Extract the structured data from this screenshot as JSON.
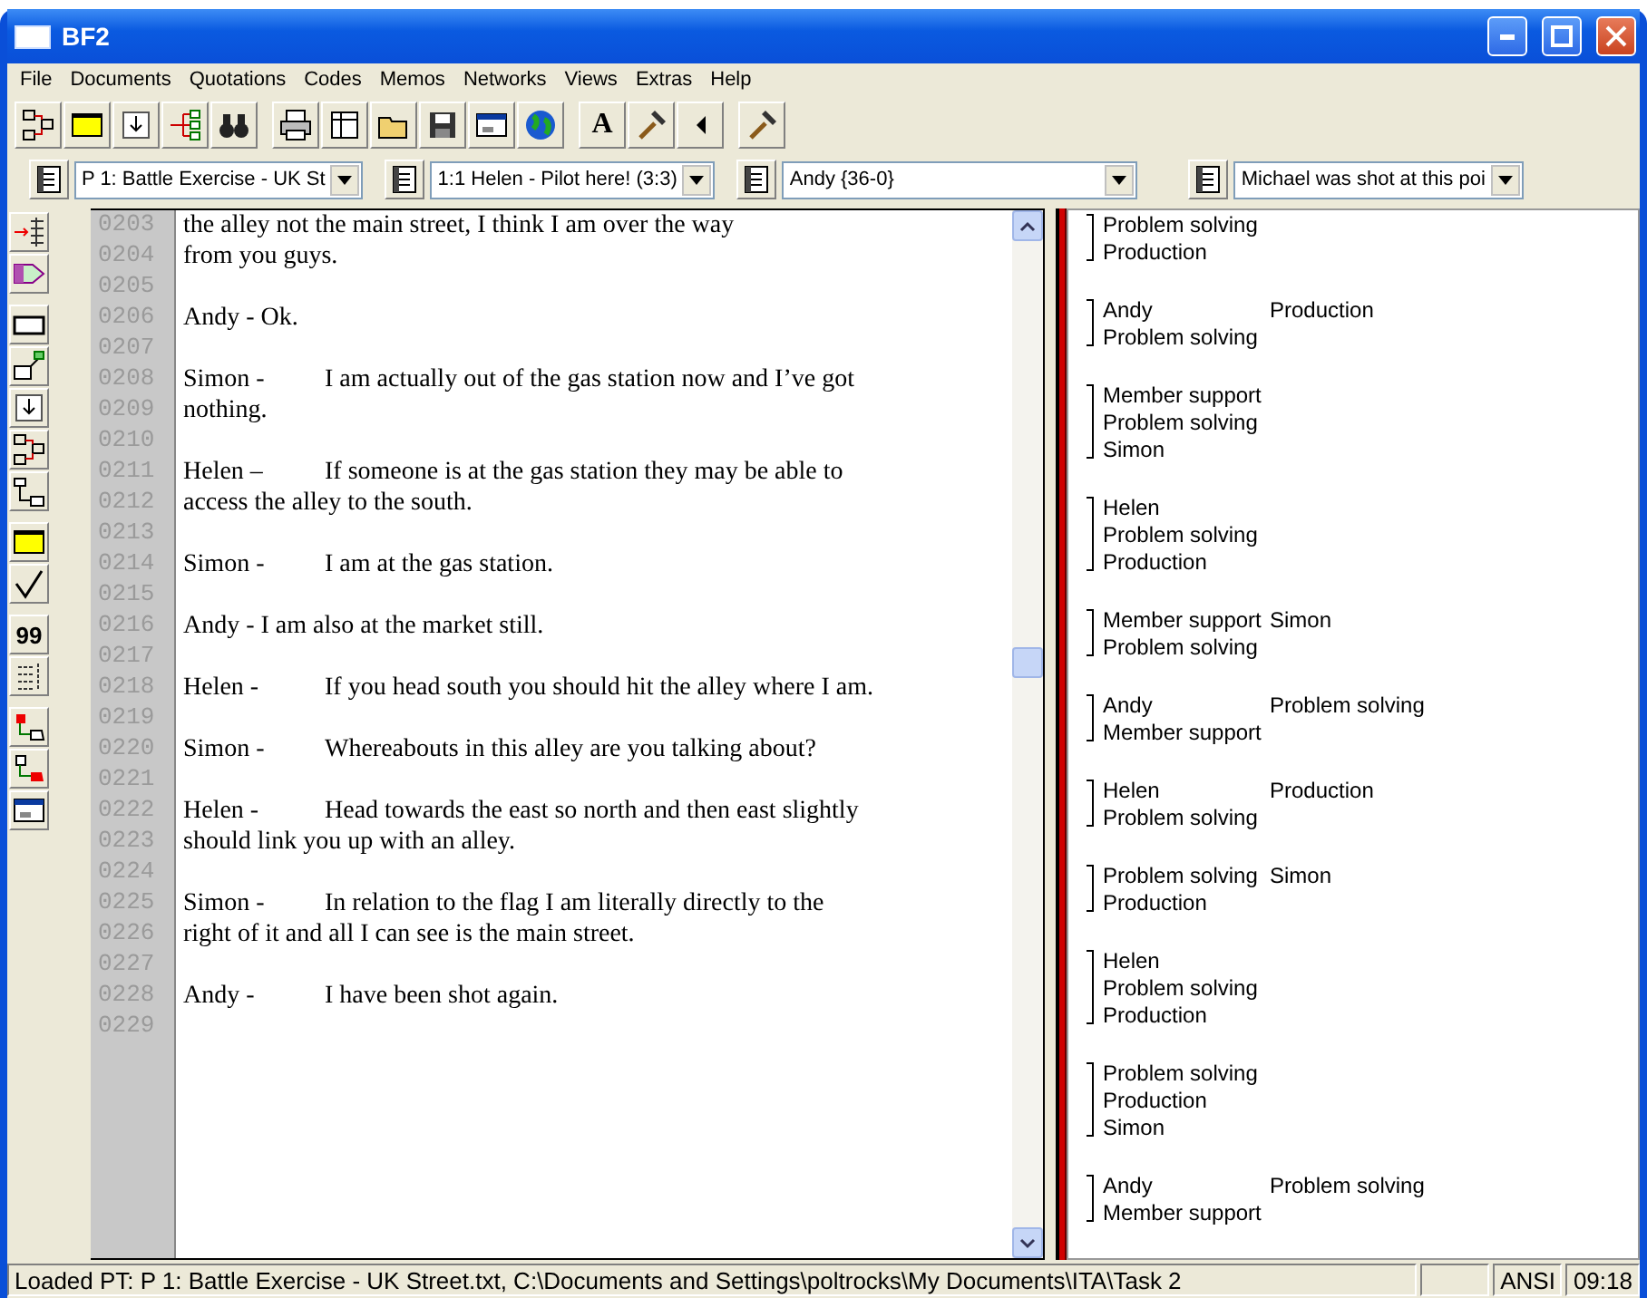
{
  "window": {
    "title": "BF2"
  },
  "menu": [
    "File",
    "Documents",
    "Quotations",
    "Codes",
    "Memos",
    "Networks",
    "Views",
    "Extras",
    "Help"
  ],
  "toolbar": [
    [
      {
        "kind": "network"
      },
      {
        "kind": "yellow-window"
      },
      {
        "kind": "import"
      },
      {
        "kind": "tree"
      },
      {
        "kind": "binoculars"
      }
    ],
    [
      {
        "kind": "printer"
      },
      {
        "kind": "table"
      },
      {
        "kind": "folder"
      },
      {
        "kind": "save"
      },
      {
        "kind": "window"
      },
      {
        "kind": "globe"
      }
    ],
    [
      {
        "kind": "text",
        "label": "A"
      },
      {
        "kind": "hammer"
      },
      {
        "kind": "left-arrow"
      }
    ],
    [
      {
        "kind": "hammer"
      }
    ]
  ],
  "selectors": [
    {
      "value": "P 1: Battle Exercise - UK St"
    },
    {
      "value": "1:1 Helen - Pilot here! (3:3)"
    },
    {
      "value": "Andy {36-0}"
    },
    {
      "value": "Michael was shot at this poi"
    }
  ],
  "side_toolbar": [
    [
      {
        "kind": "arrow-lines"
      },
      {
        "kind": "tag"
      }
    ],
    [
      {
        "kind": "rectangle"
      },
      {
        "kind": "memo-link"
      },
      {
        "kind": "import"
      },
      {
        "kind": "network"
      },
      {
        "kind": "connector"
      }
    ],
    [
      {
        "kind": "yellow-window"
      },
      {
        "kind": "check"
      }
    ],
    [
      {
        "kind": "text",
        "label": "99"
      },
      {
        "kind": "bars"
      }
    ],
    [
      {
        "kind": "link-red"
      },
      {
        "kind": "link-red-2"
      },
      {
        "kind": "window"
      }
    ]
  ],
  "document_lines": [
    {
      "number": "0203",
      "text": "the alley not the main street, I think I am over the way"
    },
    {
      "number": "0204",
      "text": "from you guys."
    },
    {
      "number": "0205"
    },
    {
      "number": "0206",
      "text": "Andy -  Ok."
    },
    {
      "number": "0207"
    },
    {
      "number": "0208",
      "speaker": "Simon -",
      "text": "I am actually out of the gas station now and I’ve got"
    },
    {
      "number": "0209",
      "text": "nothing."
    },
    {
      "number": "0210"
    },
    {
      "number": "0211",
      "speaker": "Helen –",
      "text": "If someone is at the gas station they may be able to"
    },
    {
      "number": "0212",
      "text": "access the alley to the south."
    },
    {
      "number": "0213"
    },
    {
      "number": "0214",
      "speaker": "Simon -",
      "text": "I am at the gas station."
    },
    {
      "number": "0215"
    },
    {
      "number": "0216",
      "text": "Andy -  I am also at the market still."
    },
    {
      "number": "0217"
    },
    {
      "number": "0218",
      "speaker": "Helen -",
      "text": "If you head south you should hit the alley where I am."
    },
    {
      "number": "0219"
    },
    {
      "number": "0220",
      "speaker": "Simon -",
      "text": "Whereabouts in this alley are you talking about?"
    },
    {
      "number": "0221"
    },
    {
      "number": "0222",
      "speaker": "Helen -",
      "text": "Head towards the east so north and then east slightly"
    },
    {
      "number": "0223",
      "text": "should link you up with an alley."
    },
    {
      "number": "0224"
    },
    {
      "number": "0225",
      "speaker": "Simon -",
      "text": "In relation to the flag I am literally directly to the"
    },
    {
      "number": "0226",
      "text": "right of it and all I can see is the main street."
    },
    {
      "number": "0227"
    },
    {
      "number": "0228",
      "speaker": "Andy -",
      "text": "I have been shot again."
    },
    {
      "number": "0229"
    }
  ],
  "margin_codes": [
    {
      "rows": [
        [
          "Problem solving"
        ],
        [
          "Production"
        ]
      ]
    },
    {
      "rows": [
        [
          "Andy",
          "Production"
        ],
        [
          "Problem solving"
        ]
      ]
    },
    {
      "rows": [
        [
          "Member support"
        ],
        [
          "Problem solving"
        ],
        [
          "Simon"
        ]
      ]
    },
    {
      "rows": [
        [
          "Helen"
        ],
        [
          "Problem solving"
        ],
        [
          "Production"
        ]
      ]
    },
    {
      "rows": [
        [
          "Member support",
          "Simon"
        ],
        [
          "Problem solving"
        ]
      ]
    },
    {
      "rows": [
        [
          "Andy",
          "Problem solving"
        ],
        [
          "Member support"
        ]
      ]
    },
    {
      "rows": [
        [
          "Helen",
          "Production"
        ],
        [
          "Problem solving"
        ]
      ]
    },
    {
      "rows": [
        [
          "Problem solving",
          "Simon"
        ],
        [
          "Production"
        ]
      ]
    },
    {
      "rows": [
        [
          "Helen"
        ],
        [
          "Problem solving"
        ],
        [
          "Production"
        ]
      ]
    },
    {
      "rows": [
        [
          "Problem solving"
        ],
        [
          "Production"
        ],
        [
          "Simon"
        ]
      ]
    },
    {
      "rows": [
        [
          "Andy",
          "Problem solving"
        ],
        [
          "Member support"
        ]
      ]
    }
  ],
  "status_bar": {
    "message": "Loaded PT: P 1: Battle Exercise - UK Street.txt, C:\\Documents and Settings\\poltrocks\\My Documents\\ITA\\Task 2",
    "encoding": "ANSI",
    "time": "09:18"
  }
}
